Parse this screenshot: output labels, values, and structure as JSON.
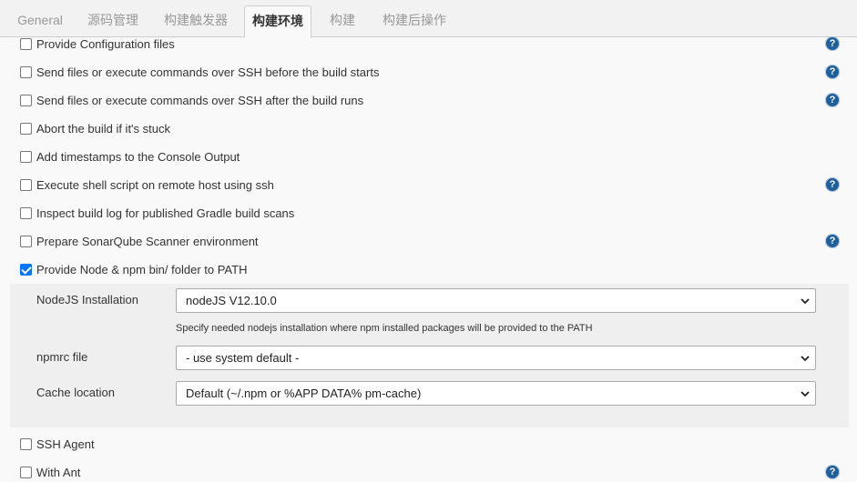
{
  "tabs": [
    {
      "label": "General"
    },
    {
      "label": "源码管理"
    },
    {
      "label": "构建触发器"
    },
    {
      "label": "构建环境"
    },
    {
      "label": "构建"
    },
    {
      "label": "构建后操作"
    }
  ],
  "active_tab": "构建环境",
  "options": [
    {
      "label": "Provide Configuration files",
      "checked": false,
      "help": true
    },
    {
      "label": "Send files or execute commands over SSH before the build starts",
      "checked": false,
      "help": true
    },
    {
      "label": "Send files or execute commands over SSH after the build runs",
      "checked": false,
      "help": true
    },
    {
      "label": "Abort the build if it's stuck",
      "checked": false,
      "help": false
    },
    {
      "label": "Add timestamps to the Console Output",
      "checked": false,
      "help": false
    },
    {
      "label": "Execute shell script on remote host using ssh",
      "checked": false,
      "help": true
    },
    {
      "label": "Inspect build log for published Gradle build scans",
      "checked": false,
      "help": false
    },
    {
      "label": "Prepare SonarQube Scanner environment",
      "checked": false,
      "help": true
    },
    {
      "label": "Provide Node & npm bin/ folder to PATH",
      "checked": true,
      "help": false
    },
    {
      "label": "SSH Agent",
      "checked": false,
      "help": false
    },
    {
      "label": "With Ant",
      "checked": false,
      "help": true
    }
  ],
  "node_config": {
    "nodejs_label": "NodeJS Installation",
    "nodejs_value": "nodeJS  V12.10.0",
    "nodejs_hint": "Specify needed nodejs installation where npm installed packages will be provided to the PATH",
    "npmrc_label": "npmrc file",
    "npmrc_value": "- use system default -",
    "cache_label": "Cache location",
    "cache_value": "Default (~/.npm or %APP  DATA% pm-cache)"
  },
  "help_glyph": "?",
  "icons": {
    "help": "question-circle-icon",
    "dropdown": "chevron-down-icon"
  },
  "colors": {
    "accent": "#0075ff",
    "help_icon": "#1f5f9c",
    "panel_bg": "#efefef",
    "page_bg": "#f9f9f9"
  }
}
